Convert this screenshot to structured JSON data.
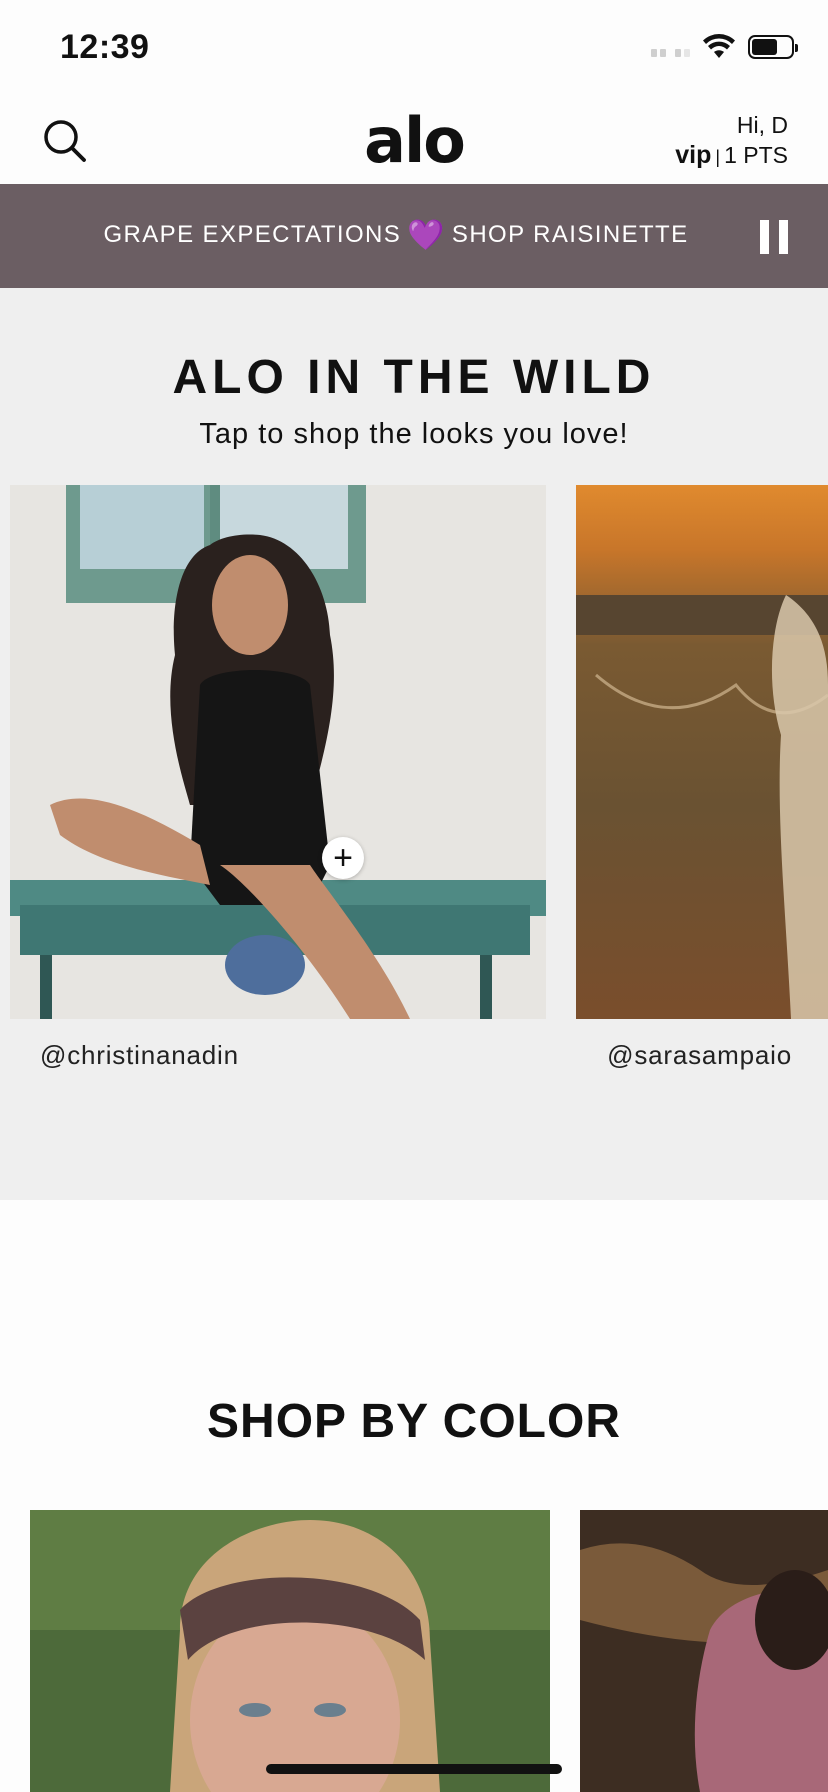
{
  "status_bar": {
    "time": "12:39",
    "battery_level": 0.65,
    "icons": [
      "signal-icon",
      "wifi-icon",
      "battery-icon"
    ]
  },
  "header": {
    "search_icon": "search-icon",
    "logo": "alo",
    "greeting": "Hi, D",
    "vip_label": "vip",
    "separator": "|",
    "points": "1 PTS"
  },
  "promo": {
    "text_left": "GRAPE EXPECTATIONS",
    "heart": "💜",
    "text_right": "SHOP RAISINETTE",
    "pause_icon": "pause-icon"
  },
  "wild": {
    "title": "ALO IN THE WILD",
    "subtitle": "Tap to shop the looks you love!",
    "cards": [
      {
        "handle": "@christinanadin",
        "plus": "+"
      },
      {
        "handle": "@sarasampaio"
      }
    ]
  },
  "shop_by_color": {
    "title": "SHOP BY COLOR"
  },
  "colors": {
    "promo_bg": "#6b5e63",
    "wild_bg": "#efefef",
    "accent_heart": "#b04af0"
  }
}
